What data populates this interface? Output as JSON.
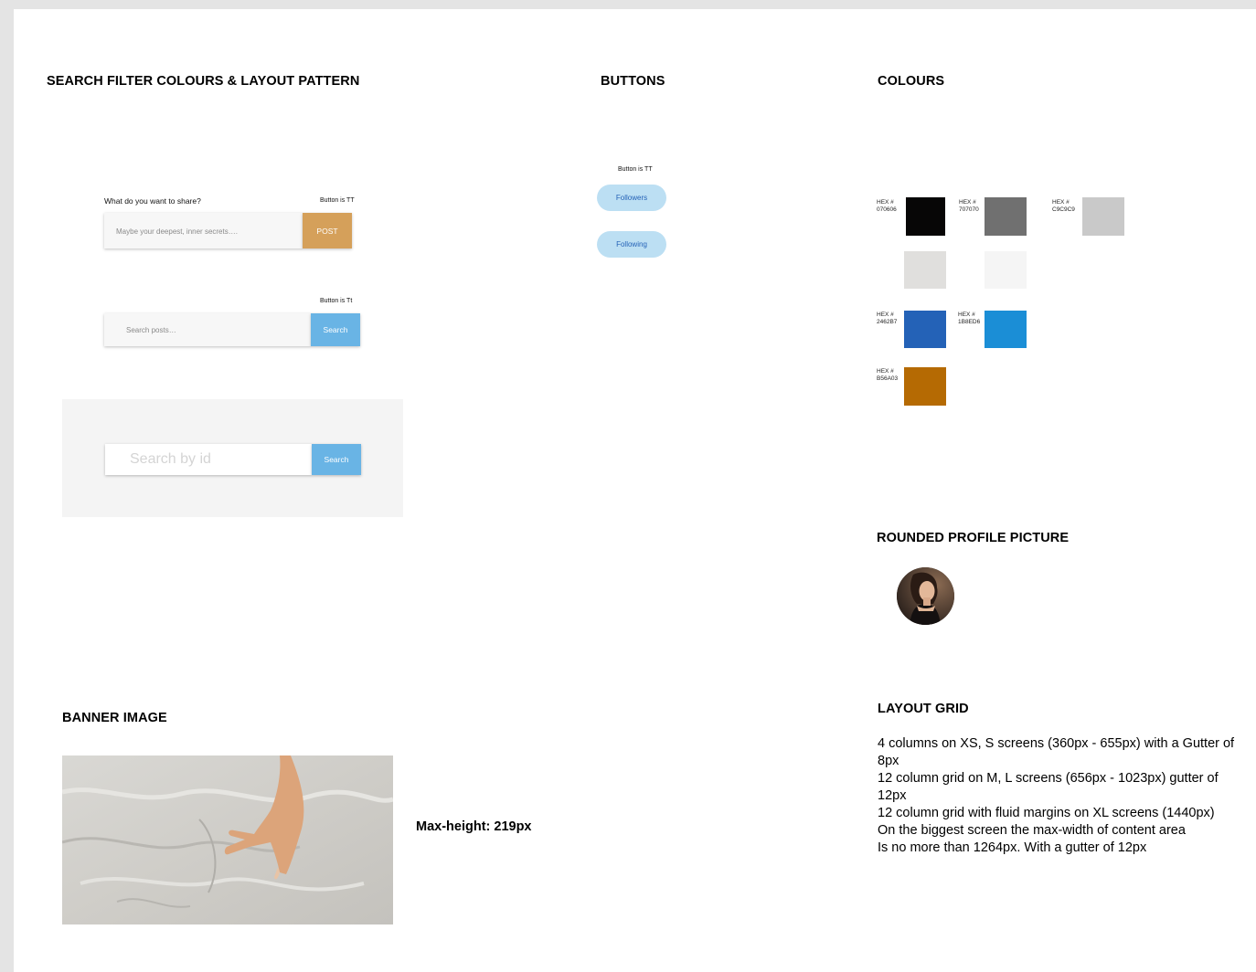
{
  "search_section": {
    "title": "SEARCH FILTER COLOURS & LAYOUT PATTERN",
    "share_prompt": "What do you want to share?",
    "post_note": "Button is TT",
    "share_placeholder": "Maybe your deepest, inner secrets….",
    "post_label": "POST",
    "search_note": "Button is Tt",
    "search_posts_placeholder": "Search posts…",
    "search_label": "Search",
    "search_id_placeholder": "Search by id",
    "search_id_label": "Search"
  },
  "buttons_section": {
    "title": "BUTTONS",
    "note": "Button is TT",
    "followers_label": "Followers",
    "following_label": "Following"
  },
  "colours_section": {
    "title": "COLOURS",
    "swatches": [
      {
        "hex_label": "HEX #",
        "code": "070606",
        "color": "#070606"
      },
      {
        "hex_label": "HEX #",
        "code": "707070",
        "color": "#707070"
      },
      {
        "hex_label": "HEX #",
        "code": "C9C9C9",
        "color": "#C9C9C9"
      },
      {
        "hex_label": "",
        "code": "",
        "color": "#E0DFDD"
      },
      {
        "hex_label": "",
        "code": "",
        "color": "#F5F5F5"
      },
      {
        "hex_label": "HEX #",
        "code": "2462B7",
        "color": "#2462B7"
      },
      {
        "hex_label": "HEX #",
        "code": "1B8ED6",
        "color": "#1B8ED6"
      },
      {
        "hex_label": "HEX #",
        "code": "B56A03",
        "color": "#B56A03"
      }
    ]
  },
  "profile_section": {
    "title": "ROUNDED PROFILE PICTURE"
  },
  "banner_section": {
    "title": "BANNER IMAGE",
    "max_height_label": "Max-height: 219px"
  },
  "layout_grid": {
    "title": "LAYOUT GRID",
    "lines": [
      "4 columns on XS, S screens (360px - 655px) with a Gutter of 8px",
      "12 column grid on M, L screens (656px - 1023px) gutter of 12px",
      "12 column grid with fluid margins on XL screens (1440px)",
      "On the biggest screen the max-width of content area",
      "Is no more than 1264px. With a gutter of 12px"
    ]
  }
}
